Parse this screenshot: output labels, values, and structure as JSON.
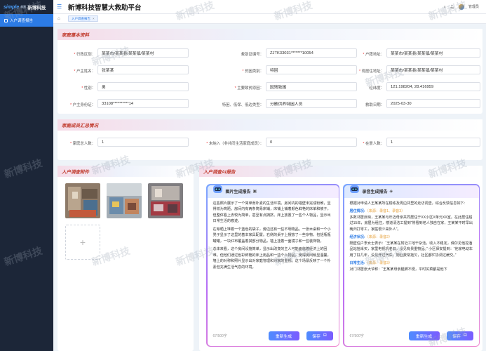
{
  "sidebar": {
    "logo_simple": "simple",
    "logo_tag": "标准",
    "logo_brand": "新博科技",
    "items": [
      {
        "label": "入户调查报告"
      }
    ]
  },
  "header": {
    "title": "新博科技智慧大救助平台",
    "user": "管理员"
  },
  "tabs": [
    {
      "label": "入户调查报告"
    }
  ],
  "watermark": "新博科技",
  "basic": {
    "title": "家庭基本资料",
    "fields": [
      {
        "label": "行政区划：",
        "required": true,
        "value": "某某市/某某县/某某镇/某某村"
      },
      {
        "label": "救助证编号：",
        "required": false,
        "value": "ZJTK33031*******10054"
      },
      {
        "label": "户籍地址：",
        "required": true,
        "value": "某某市/某某县/某某镇/某某村"
      },
      {
        "label": "户主姓名：",
        "required": true,
        "value": "张某某"
      },
      {
        "label": "贫困类别：",
        "required": true,
        "value": "特困"
      },
      {
        "label": "现居住地址：",
        "required": true,
        "value": "某某市/某某县/某某镇/某某村"
      },
      {
        "label": "性别：",
        "required": true,
        "value": "男"
      },
      {
        "label": "主要致贫原因：",
        "required": true,
        "value": "因残致困"
      },
      {
        "label": "经纬度：",
        "required": false,
        "value": "121.198204, 28.416959"
      },
      {
        "label": "户主身份证：",
        "required": true,
        "value": "33108**********14"
      },
      {
        "label": "特困、低保、低边类型：",
        "required": false,
        "value": "分散供养特困人员"
      },
      {
        "label": "救助日期：",
        "required": false,
        "value": "2025-03-30"
      }
    ]
  },
  "members": {
    "title": "家庭成员汇总情况",
    "fields": [
      {
        "label": "家庭总人数：",
        "required": true,
        "value": "1"
      },
      {
        "label": "未纳入（非共同生活家庭成员）：",
        "required": true,
        "value": "0"
      },
      {
        "label": "在册人数：",
        "required": true,
        "value": "1"
      }
    ]
  },
  "attachments": {
    "title": "入户调查附件",
    "add_symbol": "+"
  },
  "ai": {
    "title": "入户调查AI报告",
    "photo_report": {
      "title": "图片生成报告",
      "paragraphs": [
        "这些照片展示了一个简单而朴素的生活环境。房间内的墙壁未完成粉刷，显得较为简陋。房间内有两条简易床铺，床铺上铺着颜色鲜艳的床单和被子，但整体看上去较为简单，甚至有点拥挤。床上放置了一些个人物品，显示出日常生活的痕迹。",
        "在晾晒上堆着一个蓝色的袋子，旁边还有一些不明物品。一张木桌和一个小凳子显示了这里的基本家具配置。右侧的桌子上摆放了一些杂物，包括瓶瓶罐罐，一块红布覆盖着其部分物品，墙上挂着一面镜子和一些装饰物。",
        "总体来看，这个房间设施简单，显示出改变的主人可能面临着经济上的困难。但他们通过色彩鲜艳的床上用品和一些个人物品，使得房间稍显温馨。墙上的对称和照片显示出对家庭管理和对家的重视。这个场景反映了一个朴素但充满生活气息的环境。"
      ],
      "count": "67/500字",
      "regen": "重新生成",
      "save": "保存"
    },
    "audio_report": {
      "title": "录音生成报告",
      "intro": "根据对申请人王某某所在楼栋及周边邻里的走访调查，综合反馈信息如下:",
      "sections": [
        {
          "heading": "居住情况:",
          "source": "（来源：录音1、录音3）",
          "text": "多数邻居反映，王某某与年迈母亲共同居住于XX小区X单元XX室。在此居住超过15年，房屋为租住，楼道清洁工提到“常看到老人独自在家，王某某平时早出晚归打零工，家庭很少来外人”。"
        },
        {
          "heading": "经济状况:",
          "source": "（来源：录音2）",
          "text": "隔壁住户李女士表示：“王某某在附近工地干杂活，收入不稳定，偶尔见他挖酒品站拾采买，家里电视机老旧，没见有贵重物品。”\n小区保安提到：“他家电动车用了好几年，没见开过汽车，物业费常拖欠，社区都忙协调过缓交。”"
        },
        {
          "heading": "日常生活:",
          "source": "（来源：录音3）",
          "text": "对门邻居张大爷称：“王某某母亲腿脚不便，平时买菜都是他下"
        }
      ],
      "count": "67/500字",
      "regen": "重新生成",
      "save": "保存"
    }
  }
}
